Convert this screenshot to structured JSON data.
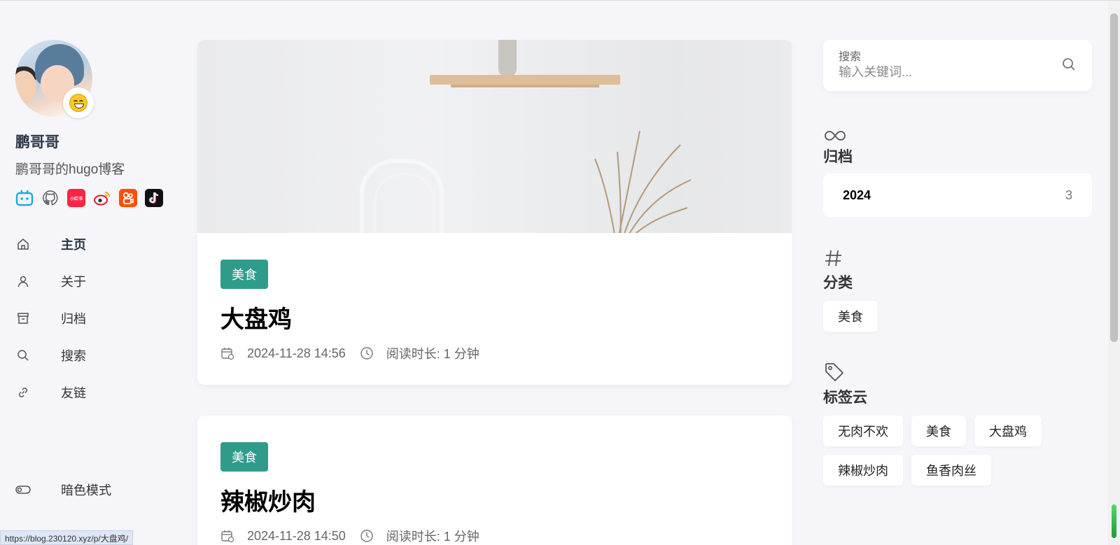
{
  "profile": {
    "name": "鹏哥哥",
    "description": "鹏哥哥的hugo博客"
  },
  "social": [
    "bilibili-icon",
    "github-icon",
    "xiaohongshu-icon",
    "weibo-icon",
    "kuaishou-icon",
    "tiktok-icon"
  ],
  "social_labels": {
    "xiaohongshu": "小红书"
  },
  "menu": [
    {
      "label": "主页",
      "icon": "home-icon",
      "active": true
    },
    {
      "label": "关于",
      "icon": "user-icon",
      "active": false
    },
    {
      "label": "归档",
      "icon": "archive-icon",
      "active": false
    },
    {
      "label": "搜索",
      "icon": "search-icon",
      "active": false
    },
    {
      "label": "友链",
      "icon": "link-icon",
      "active": false
    }
  ],
  "dark_mode_label": "暗色模式",
  "posts": [
    {
      "category": "美食",
      "title": "大盘鸡",
      "date": "2024-11-28 14:56",
      "reading_time": "阅读时长: 1 分钟"
    },
    {
      "category": "美食",
      "title": "辣椒炒肉",
      "date": "2024-11-28 14:50",
      "reading_time": "阅读时长: 1 分钟"
    }
  ],
  "search": {
    "label": "搜索",
    "placeholder": "输入关键词..."
  },
  "archives": {
    "title": "归档",
    "items": [
      {
        "year": "2024",
        "count": "3"
      }
    ]
  },
  "categories": {
    "title": "分类",
    "items": [
      "美食"
    ]
  },
  "tag_cloud": {
    "title": "标签云",
    "items": [
      "无肉不欢",
      "美食",
      "大盘鸡",
      "辣椒炒肉",
      "鱼香肉丝"
    ]
  },
  "status_url": "https://blog.230120.xyz/p/大盘鸡/",
  "colors": {
    "accent": "#2f9c8b",
    "background": "#f5f5fa",
    "heading": "#2b3648"
  }
}
